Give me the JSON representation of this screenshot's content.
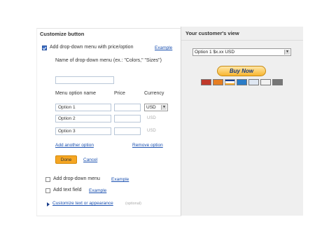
{
  "left": {
    "title": "Customize button",
    "dropdown_price_label": "Add drop-down menu with price/option",
    "example1": "Example",
    "name_label": "Name of drop-down menu (ex.: \"Colors,\" \"Sizes\")",
    "headers": {
      "name": "Menu option name",
      "price": "Price",
      "currency": "Currency"
    },
    "options": [
      {
        "name": "Option 1",
        "price": "",
        "currency": "USD"
      },
      {
        "name": "Option 2",
        "price": "",
        "currency": "USD"
      },
      {
        "name": "Option 3",
        "price": "",
        "currency": "USD"
      }
    ],
    "add_option": "Add another option",
    "remove_option": "Remove option",
    "done": "Done",
    "cancel": "Cancel",
    "dropdown_label": "Add drop-down menu",
    "example2": "Example",
    "textfield_label": "Add text field",
    "example3": "Example",
    "customize_link": "Customize text or appearance",
    "optional": "(optional)"
  },
  "right": {
    "title": "Your customer's view",
    "select_value": "Option 1 $x.xx USD",
    "buy_now": "Buy Now",
    "card_icons": [
      "mastercard-icon",
      "discover-icon",
      "visa-icon",
      "amex-icon",
      "echeck-icon",
      "paypal-icon",
      "bank-icon"
    ]
  },
  "colors": {
    "accent": "#f5a623",
    "link": "#1a50b0",
    "panel_bg": "#efefef"
  }
}
